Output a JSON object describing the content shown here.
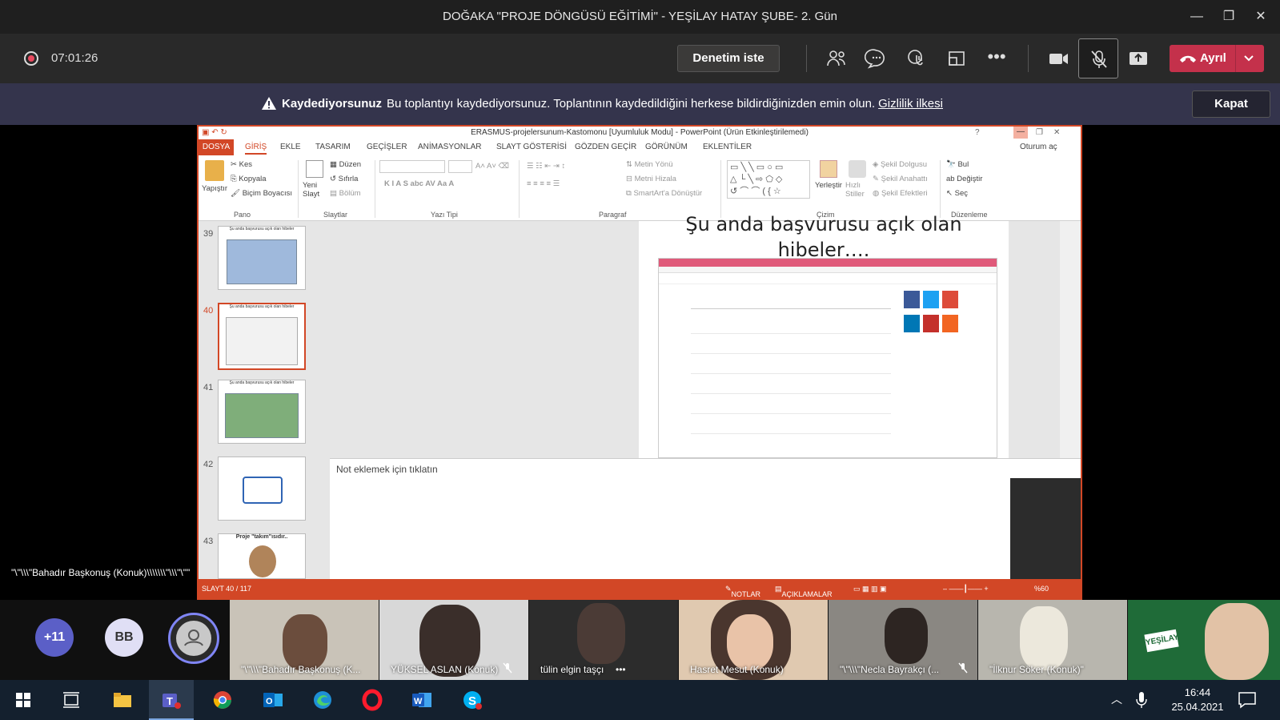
{
  "window": {
    "title": "DOĞAKA \"PROJE DÖNGÜSÜ EĞİTİMİ\" - YEŞİLAY HATAY ŞUBE- 2. Gün"
  },
  "toolbar": {
    "timer": "07:01:26",
    "request_control": "Denetim iste",
    "leave": "Ayrıl"
  },
  "banner": {
    "bold": "Kaydediyorsunuz",
    "text": "Bu toplantıyı kaydediyorsunuz. Toplantının kaydedildiğini herkese bildirdiğinizden emin olun.",
    "link": "Gizlilik ilkesi",
    "close": "Kapat"
  },
  "ppt": {
    "title": "ERASMUS-projelersunum-Kastomonu [Uyumluluk Modu] - PowerPoint (Ürün Etkinleştirilemedi)",
    "signin": "Oturum aç",
    "tabs": [
      "DOSYA",
      "GİRİŞ",
      "EKLE",
      "TASARIM",
      "GEÇİŞLER",
      "ANİMASYONLAR",
      "SLAYT GÖSTERİSİ",
      "GÖZDEN GEÇİR",
      "GÖRÜNÜM",
      "EKLENTİLER"
    ],
    "ribbon": {
      "paste": "Yapıştır",
      "cut": "Kes",
      "copy": "Kopyala",
      "format_painter": "Biçim Boyacısı",
      "new_slide": "Yeni Slayt",
      "layout": "Düzen",
      "reset": "Sıfırla",
      "section": "Bölüm",
      "text_direction": "Metin Yönü",
      "align_text": "Metni Hizala",
      "smartart": "SmartArt'a Dönüştür",
      "arrange": "Yerleştir",
      "quick_styles": "Hızlı Stiller",
      "shape_fill": "Şekil Dolgusu",
      "shape_outline": "Şekil Anahattı",
      "shape_effects": "Şekil Efektleri",
      "find": "Bul",
      "replace": "Değiştir",
      "select": "Seç",
      "groups": [
        "Pano",
        "Slaytlar",
        "Yazı Tipi",
        "Paragraf",
        "Çizim",
        "Düzenleme"
      ]
    },
    "thumbnails": [
      {
        "num": "39",
        "caption": "Şu anda başvurusu açık olan hibeler"
      },
      {
        "num": "40",
        "caption": "Şu anda başvurusu açık olan hibeler"
      },
      {
        "num": "41",
        "caption": "Şu anda başvurusu açık olan hibeler"
      },
      {
        "num": "42",
        "caption": ""
      },
      {
        "num": "43",
        "caption": "Proje \"takım\"ısıdır.."
      }
    ],
    "slide_title_line1": "Şu anda başvurusu açık olan",
    "slide_title_line2": "hibeler….",
    "notes_placeholder": "Not eklemek için tıklatın",
    "status": {
      "slide": "SLAYT 40 / 117",
      "notes": "NOTLAR",
      "comments": "AÇIKLAMALAR",
      "zoom": "%60"
    }
  },
  "presenter_label": "\"\\\"\\\\\\\"Bahadır Başkonuş (Konuk)\\\\\\\\\\\\\\\"\\\\\\\"\\\"\"",
  "participants": {
    "more": "+11",
    "initials": "BB",
    "tiles": [
      "\"\\\"\\\\\\\"Bahadır Başkonuş (K...",
      "YÜKSEL ASLAN (Konuk)",
      "tülin elgin taşçı",
      "Hasret Mesut (Konuk)",
      "\"\\\"\\\\\\\"Necla Bayrakçı (...",
      "\"İlknur Söker (Konuk)\"",
      ""
    ]
  },
  "taskbar": {
    "time": "16:44",
    "date": "25.04.2021"
  },
  "colors": {
    "ppt_accent": "#d24726",
    "leave": "#c4314b",
    "banner": "#34344c"
  }
}
